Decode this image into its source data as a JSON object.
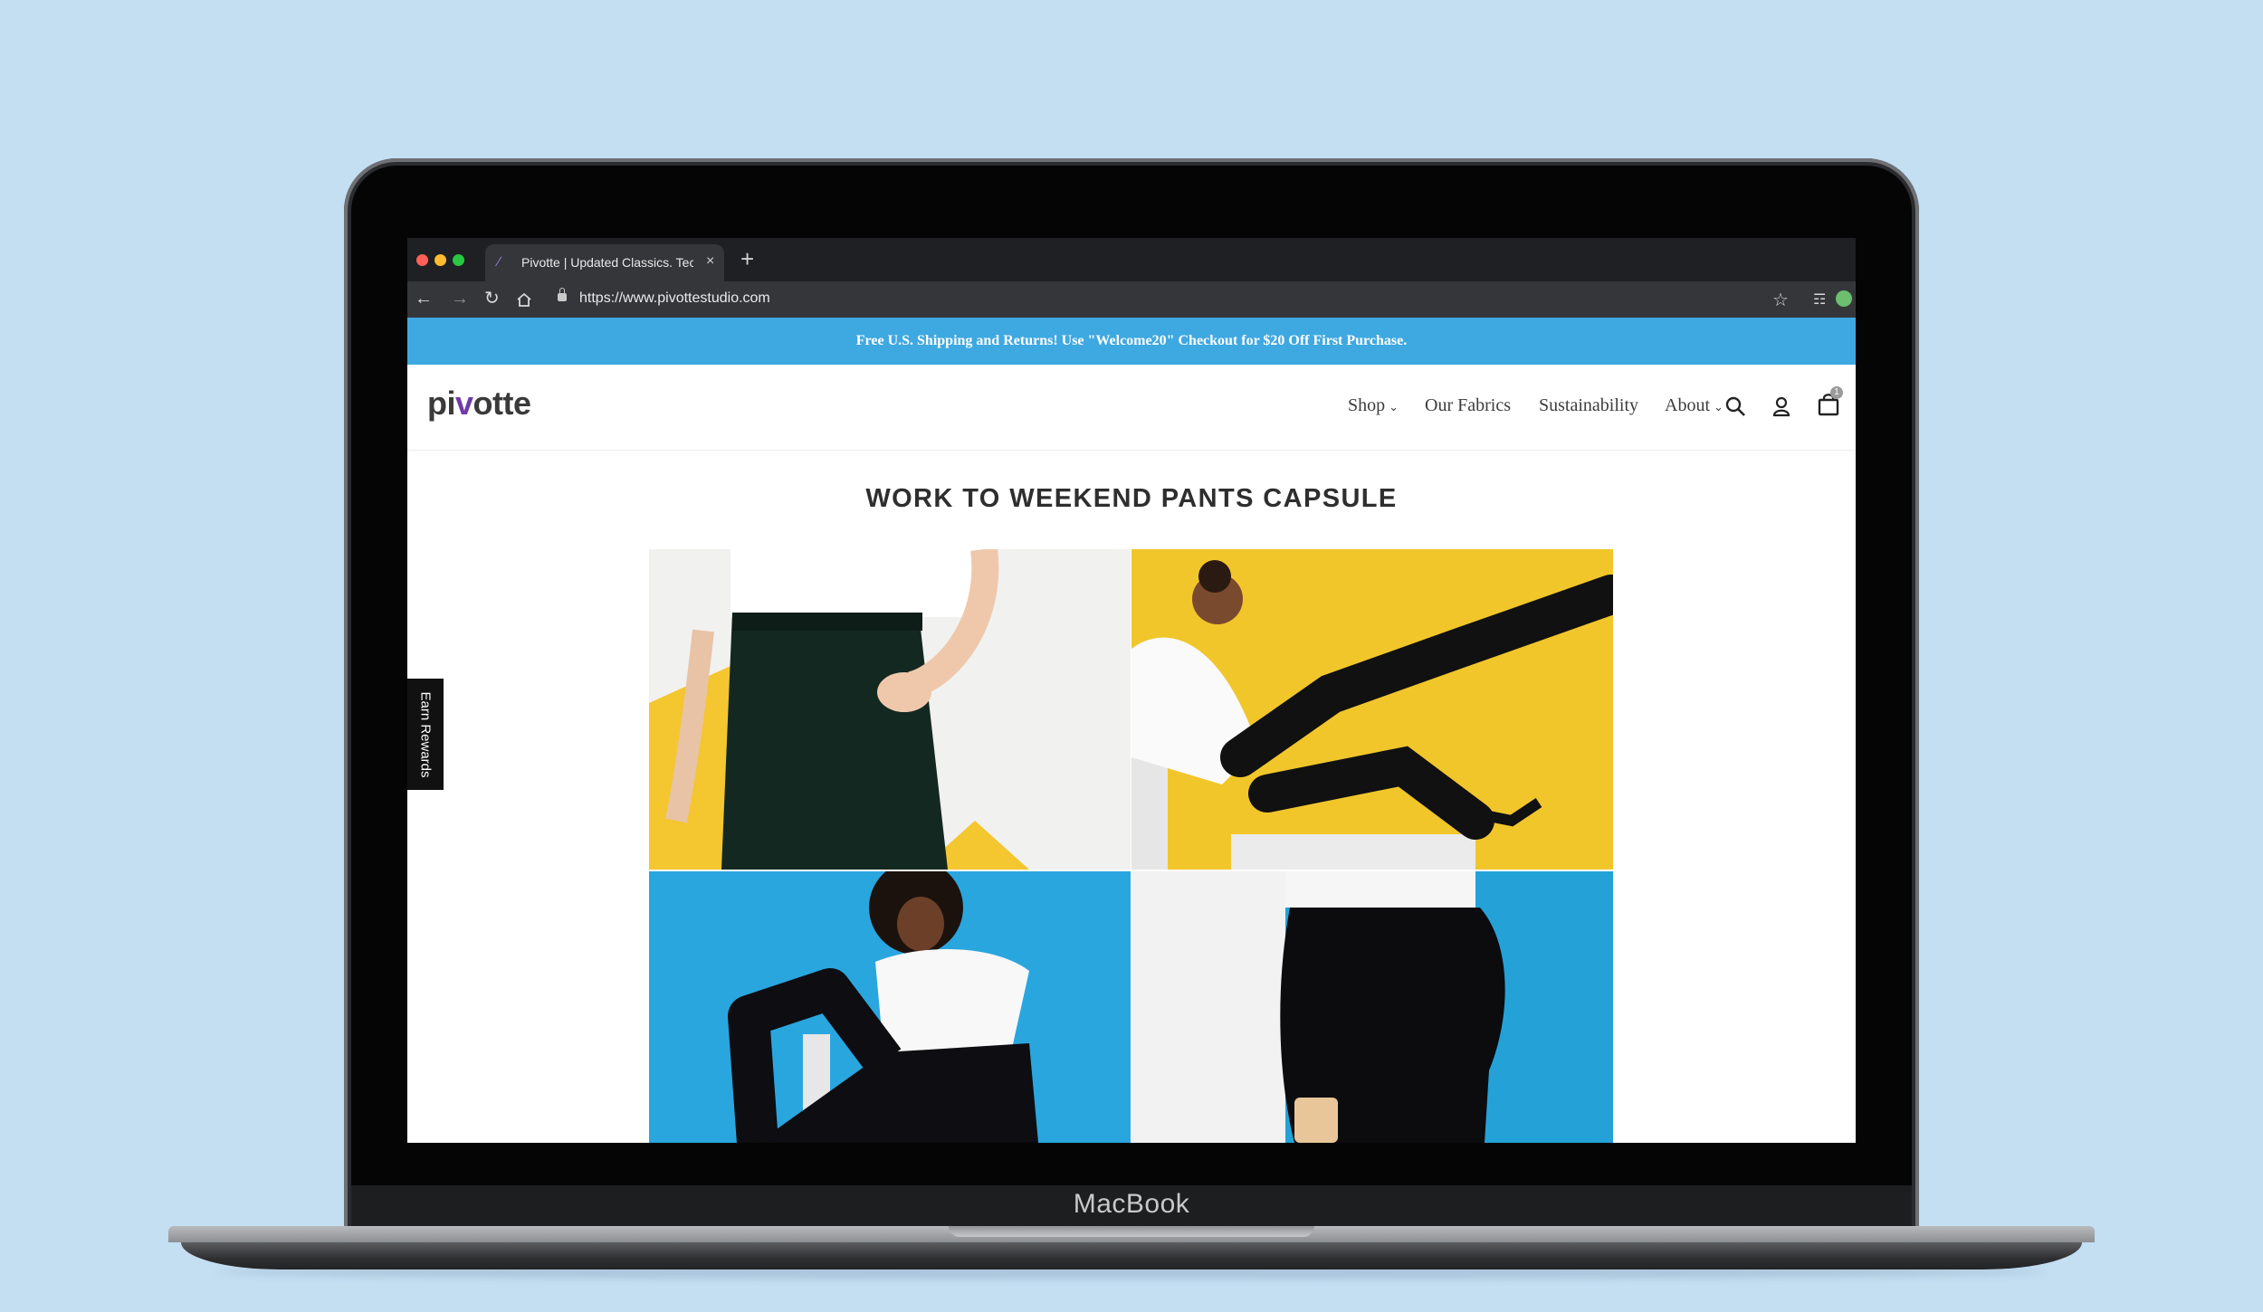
{
  "device": {
    "label": "MacBook"
  },
  "browser": {
    "tab": {
      "title": "Pivotte | Updated Classics. Tec",
      "close": "×"
    },
    "new_tab": "+",
    "url": "https://www.pivottestudio.com",
    "window_controls": {
      "close_color": "#ff5f57",
      "minimize_color": "#febc2e",
      "maximize_color": "#28c840"
    }
  },
  "site": {
    "announcement": "Free U.S. Shipping and Returns! Use \"Welcome20\" Checkout for $20 Off First Purchase.",
    "announcement_color": "#3ea8e1",
    "logo": {
      "pre": "pi",
      "accent": "v",
      "post": "otte",
      "accent_color": "#6f3aa8"
    },
    "nav": [
      {
        "label": "Shop",
        "dropdown": "⌄"
      },
      {
        "label": "Our Fabrics"
      },
      {
        "label": "Sustainability"
      },
      {
        "label": "About",
        "dropdown": "⌄"
      }
    ],
    "cart_count": "1",
    "collection_title": "WORK TO WEEKEND PANTS CAPSULE",
    "rewards_tab": "Earn Rewards"
  },
  "icons": [
    "back-arrow-icon",
    "forward-arrow-icon",
    "reload-icon",
    "home-icon",
    "lock-icon",
    "star-icon",
    "incognito-icon",
    "search-icon",
    "account-icon",
    "cart-icon"
  ]
}
